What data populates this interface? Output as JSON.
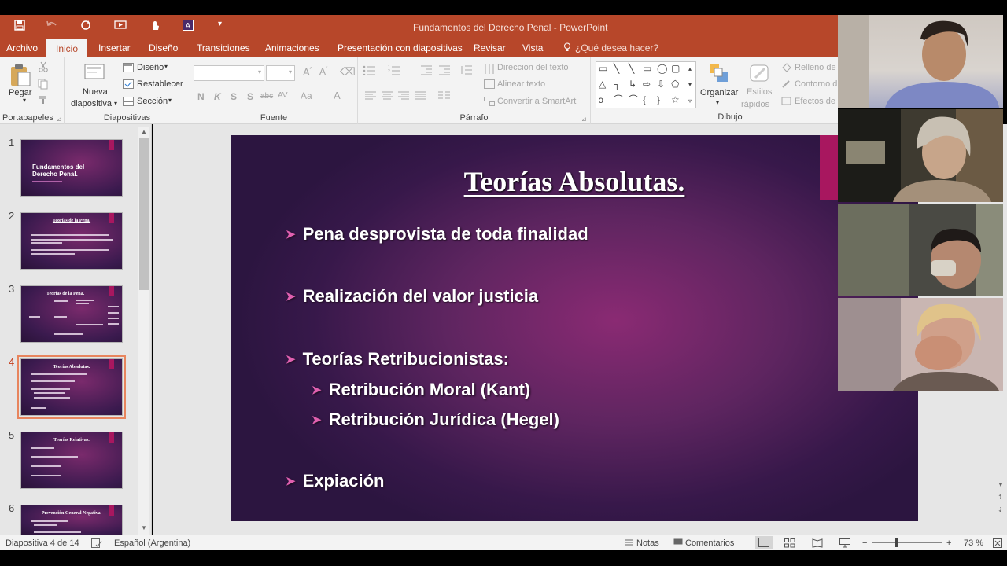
{
  "window": {
    "title": "Fundamentos del Derecho Penal - PowerPoint"
  },
  "tabs": [
    "Archivo",
    "Inicio",
    "Insertar",
    "Diseño",
    "Transiciones",
    "Animaciones",
    "Presentación con diapositivas",
    "Revisar",
    "Vista"
  ],
  "tell_me": "¿Qué desea hacer?",
  "ribbon": {
    "portapapeles": {
      "paste": "Pegar",
      "label": "Portapapeles"
    },
    "diapositivas": {
      "new_slide_1": "Nueva",
      "new_slide_2": "diapositiva",
      "layout": "Diseño",
      "reset": "Restablecer",
      "section": "Sección",
      "label": "Diapositivas"
    },
    "fuente": {
      "label": "Fuente",
      "bold": "N",
      "italic": "K",
      "underline": "S",
      "shadow": "S",
      "strike": "abc",
      "spacing": "AV",
      "case": "Aa",
      "color": "A"
    },
    "parrafo": {
      "label": "Párrafo",
      "text_direction": "Dirección del texto",
      "align_text": "Alinear texto",
      "smartart": "Convertir a SmartArt"
    },
    "dibujo": {
      "label": "Dibujo",
      "arrange": "Organizar",
      "quick_styles_1": "Estilos",
      "quick_styles_2": "rápidos",
      "fill": "Relleno de",
      "outline": "Contorno d",
      "effects": "Efectos de"
    }
  },
  "thumbnails": [
    {
      "num": "1",
      "title": "Fundamentos del Derecho Penal."
    },
    {
      "num": "2",
      "title": "Teorías de la Pena."
    },
    {
      "num": "3",
      "title": "Teorías de la Pena."
    },
    {
      "num": "4",
      "title": "Teorías Absolutas."
    },
    {
      "num": "5",
      "title": "Teorías Relativas."
    },
    {
      "num": "6",
      "title": "Prevención General Negativa."
    }
  ],
  "slide": {
    "title": "Teorías Absolutas.",
    "bullets": [
      "Pena desprovista de toda finalidad",
      "Realización del valor justicia",
      "Teorías Retribucionistas:",
      "Retribución Moral (Kant)",
      "Retribución Jurídica (Hegel)",
      "Expiación"
    ],
    "colors": {
      "accent": "#a8175f",
      "bullet_arrow": "#e060b0",
      "brand": "#b7472a"
    }
  },
  "status": {
    "slide_info": "Diapositiva 4 de 14",
    "language": "Español (Argentina)",
    "notes": "Notas",
    "comments": "Comentarios",
    "zoom": "73 %"
  },
  "participants": [
    {
      "icon": "participant-video-1"
    },
    {
      "icon": "participant-video-2"
    },
    {
      "icon": "participant-video-3"
    },
    {
      "icon": "participant-video-4"
    }
  ]
}
